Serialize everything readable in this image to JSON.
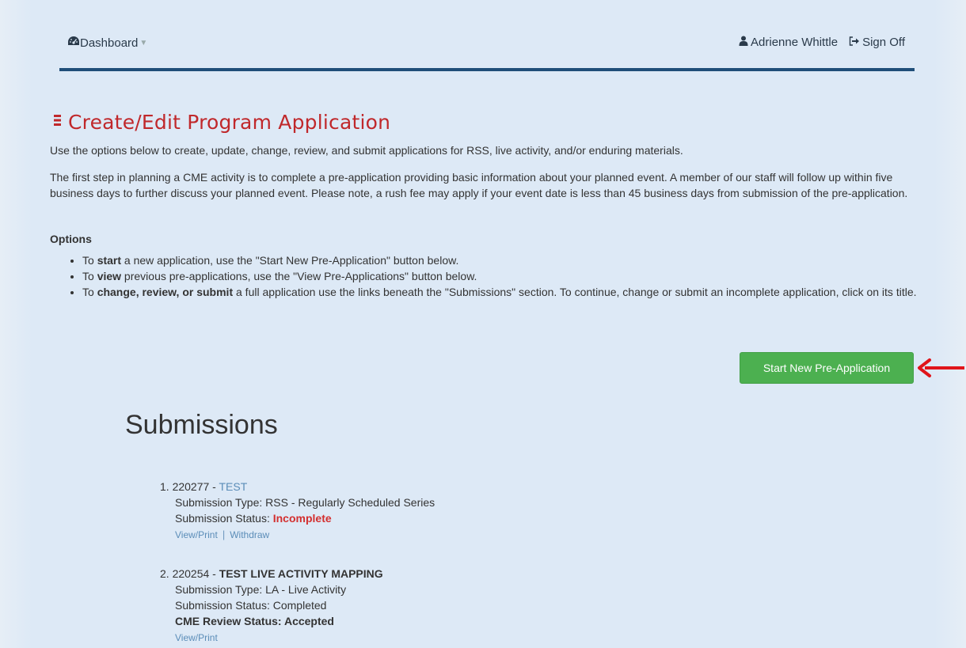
{
  "nav": {
    "dashboard_label": "Dashboard",
    "user_name": "Adrienne Whittle",
    "sign_off_label": "Sign Off"
  },
  "page": {
    "title": "Create/Edit Program Application",
    "intro": "Use the options below to create, update, change, review, and submit applications for RSS, live activity, and/or enduring materials.",
    "paragraph": "The first step in planning a CME activity is to complete a pre-application providing basic information about your planned event. A member of our staff will follow up within five business days to further discuss your planned event. Please note, a rush fee may apply if your event date is less than 45 business days from submission of the pre-application.",
    "options_heading": "Options",
    "options": [
      {
        "pre": "To ",
        "bold": "start",
        "post": " a new application, use the \"Start New Pre-Application\" button below."
      },
      {
        "pre": "To ",
        "bold": "view",
        "post": " previous pre-applications, use the \"View Pre-Applications\" button below."
      },
      {
        "pre": "To ",
        "bold": "change, review, or submit",
        "post": " a full application use the links beneath the \"Submissions\" section. To continue, change or submit an incomplete application, click on its title."
      }
    ],
    "start_button": "Start New Pre-Application"
  },
  "submissions": {
    "heading": "Submissions",
    "items": [
      {
        "number": "1.",
        "id": "220277",
        "dash": " - ",
        "title": "TEST",
        "type_label": "Submission Type:",
        "type_value": "RSS - Regularly Scheduled Series",
        "status_label": "Submission Status:",
        "status_value": "Incomplete",
        "link_view": "View/Print",
        "link_withdraw": "Withdraw"
      },
      {
        "number": "2.",
        "id": "220254",
        "dash": " - ",
        "title": "TEST LIVE ACTIVITY MAPPING",
        "type_label": "Submission Type:",
        "type_value": "LA - Live Activity",
        "status_label": "Submission Status:",
        "status_value": "Completed",
        "review_label": "CME Review Status: Accepted",
        "link_view": "View/Print"
      }
    ]
  },
  "colors": {
    "accent_red": "#c0282b",
    "button_green": "#4cb050",
    "nav_rule": "#1f4e79",
    "link_blue": "#5b8db8",
    "arrow_red": "#e0141a"
  },
  "icons": {
    "dashboard": "dashboard-gauge-icon",
    "user": "user-icon",
    "sign_off": "sign-out-icon",
    "title": "list-icon",
    "annotation": "red-arrow-icon"
  }
}
